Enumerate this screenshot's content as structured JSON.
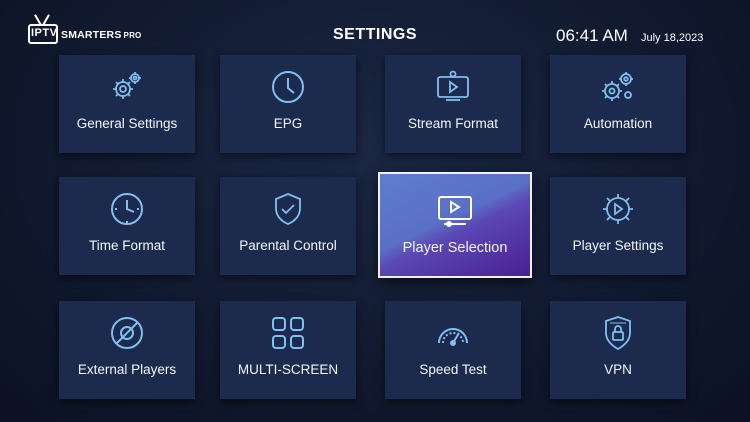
{
  "header": {
    "logo_iptv": "IPTV",
    "logo_brand": "SMARTERS",
    "logo_pro": "PRO",
    "title": "SETTINGS",
    "time": "06:41 AM",
    "date": "July 18,2023"
  },
  "colors": {
    "background": "#111a30",
    "tile": "#1c2a4e",
    "icon": "#7ec0ee",
    "selected_gradient_start": "#5e7dce",
    "selected_gradient_end": "#4a1f94"
  },
  "tiles": [
    {
      "label": "General Settings",
      "icon": "gears-icon"
    },
    {
      "label": "EPG",
      "icon": "clock-icon"
    },
    {
      "label": "Stream Format",
      "icon": "stream-format-icon"
    },
    {
      "label": "Automation",
      "icon": "automation-gears-icon"
    },
    {
      "label": "Time Format",
      "icon": "time-format-clock-icon"
    },
    {
      "label": "Parental Control",
      "icon": "shield-check-icon"
    },
    {
      "label": "Player Selection",
      "icon": "player-screen-icon",
      "selected": true
    },
    {
      "label": "Player Settings",
      "icon": "play-gear-icon"
    },
    {
      "label": "External Players",
      "icon": "external-player-icon"
    },
    {
      "label": "MULTI-SCREEN",
      "icon": "grid-icon"
    },
    {
      "label": "Speed Test",
      "icon": "speedometer-icon"
    },
    {
      "label": "VPN",
      "icon": "vpn-shield-icon"
    }
  ]
}
